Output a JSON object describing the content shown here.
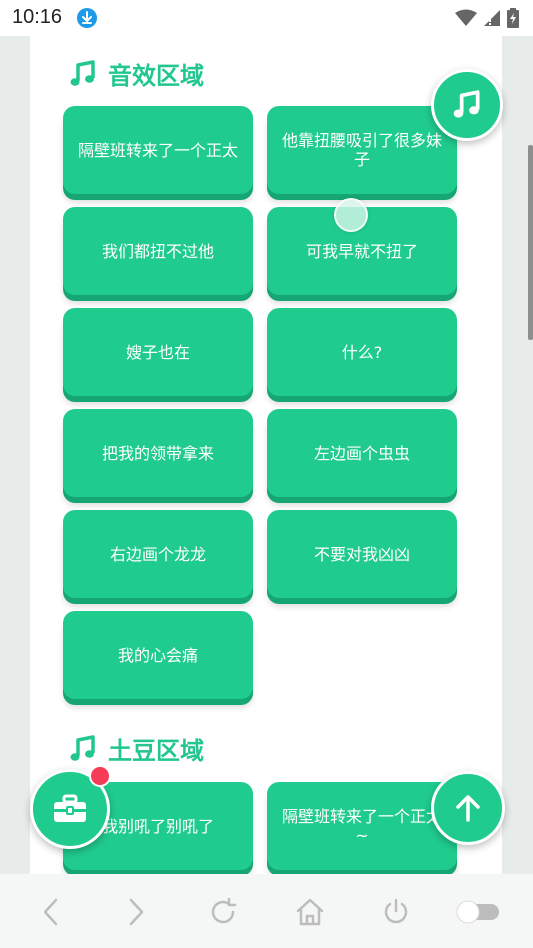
{
  "status_bar": {
    "time": "10:16",
    "icons": [
      "download-icon",
      "wifi-icon",
      "signal-icon",
      "battery-icon"
    ]
  },
  "sections": [
    {
      "title": "音效区域",
      "icon": "music-note-icon",
      "buttons": [
        "隔壁班转来了一个正太",
        "他靠扭腰吸引了很多妹子",
        "我们都扭不过他",
        "可我早就不扭了",
        "嫂子也在",
        "什么?",
        "把我的领带拿来",
        "左边画个虫虫",
        "右边画个龙龙",
        "不要对我凶凶",
        "我的心会痛"
      ]
    },
    {
      "title": "土豆区域",
      "icon": "music-note-icon",
      "buttons": [
        "我别吼了别吼了",
        "隔壁班转来了一个正太~"
      ]
    }
  ],
  "fabs": {
    "music": "music-note-icon",
    "toolbox": "toolbox-icon",
    "scroll_top": "arrow-up-icon"
  },
  "nav_bar": [
    "back-icon",
    "forward-icon",
    "refresh-icon",
    "home-icon",
    "power-icon",
    "toggle-switch"
  ],
  "colors": {
    "accent": "#20cb8e",
    "accent_dark": "#15a673",
    "badge": "#f53b55",
    "background": "#e7ebe9"
  }
}
